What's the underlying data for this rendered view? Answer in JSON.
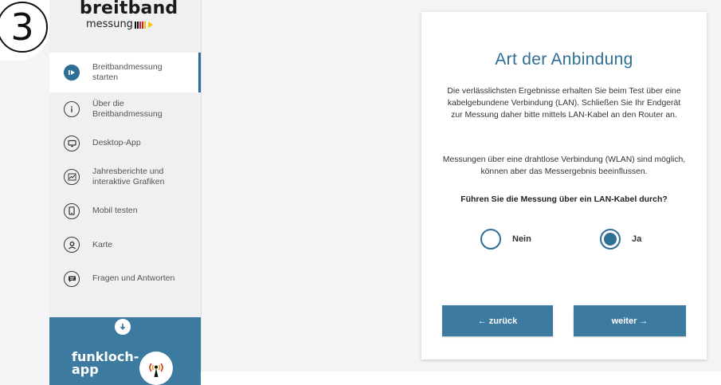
{
  "step": {
    "number": "3"
  },
  "logo": {
    "main": "breitband",
    "sub": "messung",
    "bar_colors": [
      "#000000",
      "#000000",
      "#d4202a",
      "#d4202a",
      "#f5c300"
    ]
  },
  "sidebar": {
    "items": [
      {
        "label": "Breitbandmessung starten",
        "icon": "play-icon",
        "active": true
      },
      {
        "label": "Über die Breitbandmessung",
        "icon": "info-icon",
        "active": false
      },
      {
        "label": "Desktop-App",
        "icon": "monitor-icon",
        "active": false
      },
      {
        "label": "Jahresberichte und interaktive Grafiken",
        "icon": "chart-icon",
        "active": false
      },
      {
        "label": "Mobil testen",
        "icon": "phone-icon",
        "active": false
      },
      {
        "label": "Karte",
        "icon": "map-pin-icon",
        "active": false
      },
      {
        "label": "Fragen und Antworten",
        "icon": "chat-icon",
        "active": false
      }
    ],
    "promo": {
      "text": "funkloch-app",
      "icon": "down-arrow-icon",
      "logo_icon": "signal-tower-icon"
    }
  },
  "card": {
    "title": "Art der Anbindung",
    "paragraph1": "Die verlässlichsten Ergebnisse erhalten Sie beim Test über eine kabelgebundene Verbindung (LAN). Schließen Sie Ihr Endgerät zur Messung daher bitte mittels LAN-Kabel an den Router an.",
    "paragraph2": "Messungen über eine drahtlose Verbindung (WLAN) sind möglich, können aber das Messergebnis beeinflussen.",
    "question": "Führen Sie die Messung über ein LAN-Kabel durch?",
    "options": [
      {
        "label": "Nein",
        "selected": false
      },
      {
        "label": "Ja",
        "selected": true
      }
    ],
    "back_label": "← zurück",
    "next_label": "weiter →"
  },
  "colors": {
    "accent": "#2f6f95",
    "button": "#3d7aa0",
    "sidebar_bg": "#f0f0f3"
  }
}
